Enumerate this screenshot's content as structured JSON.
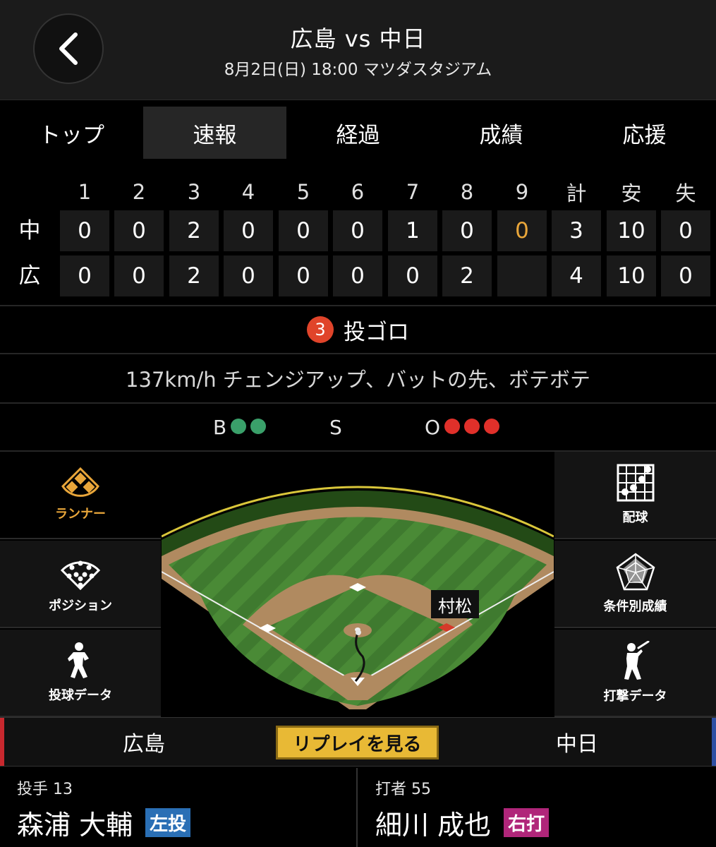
{
  "header": {
    "title": "広島 vs 中日",
    "subtitle": "8月2日(日) 18:00 マツダスタジアム"
  },
  "tabs": [
    {
      "label": "トップ",
      "active": false
    },
    {
      "label": "速報",
      "active": true
    },
    {
      "label": "経過",
      "active": false
    },
    {
      "label": "成績",
      "active": false
    },
    {
      "label": "応援",
      "active": false
    }
  ],
  "scoreboard": {
    "headers": [
      "1",
      "2",
      "3",
      "4",
      "5",
      "6",
      "7",
      "8",
      "9",
      "計",
      "安",
      "失"
    ],
    "rows": [
      {
        "team": "中",
        "cells": [
          "0",
          "0",
          "2",
          "0",
          "0",
          "0",
          "1",
          "0",
          "0",
          "3",
          "10",
          "0"
        ]
      },
      {
        "team": "広",
        "cells": [
          "0",
          "0",
          "2",
          "0",
          "0",
          "0",
          "0",
          "2",
          "",
          "4",
          "10",
          "0"
        ]
      }
    ],
    "highlight_color": "#e9a63a"
  },
  "play": {
    "out_number": "3",
    "result": "投ゴロ",
    "detail": "137km/h チェンジアップ、バットの先、ボテボテ"
  },
  "count": {
    "balls_label": "B",
    "balls": 2,
    "strikes_label": "S",
    "strikes": 0,
    "outs_label": "O",
    "outs": 3,
    "ball_color": "#3aa06a",
    "out_color": "#e0302a"
  },
  "side_left": [
    {
      "label": "ランナー",
      "icon": "diamond-bases-icon",
      "selected": true
    },
    {
      "label": "ポジション",
      "icon": "positions-icon",
      "selected": false
    },
    {
      "label": "投球データ",
      "icon": "pitcher-icon",
      "selected": false
    }
  ],
  "side_right": [
    {
      "label": "配球",
      "icon": "pitch-grid-icon"
    },
    {
      "label": "条件別成績",
      "icon": "radar-chart-icon"
    },
    {
      "label": "打撃データ",
      "icon": "batter-icon"
    }
  ],
  "field": {
    "runner_label": "村松"
  },
  "team_bar": {
    "left_team": "広島",
    "right_team": "中日",
    "replay_label": "リプレイを見る"
  },
  "pitcher": {
    "role": "投手 13",
    "name": "森浦 大輔",
    "hand": "左投",
    "hand_color": "#2a6fb5"
  },
  "batter": {
    "role": "打者 55",
    "name": "細川 成也",
    "hand": "右打",
    "hand_color": "#b0267a"
  }
}
